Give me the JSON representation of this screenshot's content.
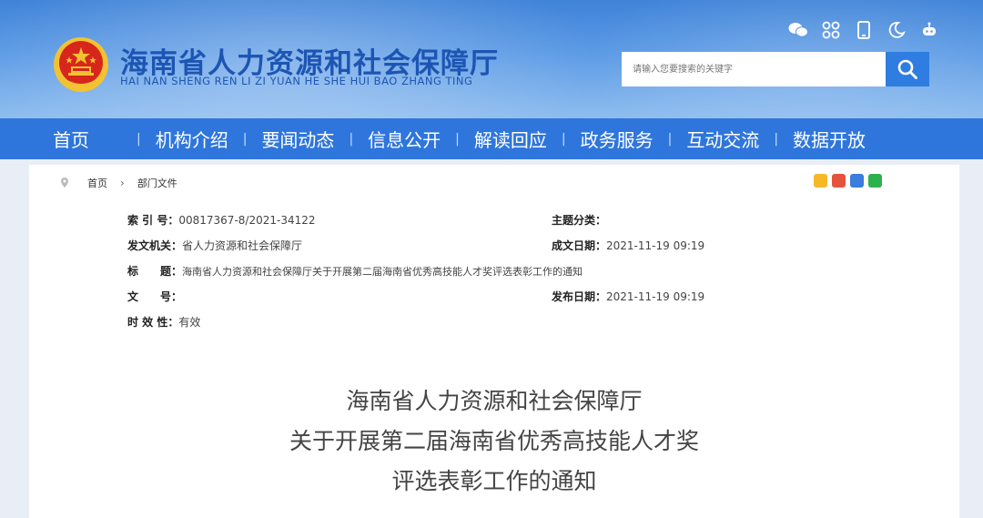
{
  "header": {
    "title": "海南省人力资源和社会保障厅",
    "subtitle": "HAI NAN SHENG REN LI ZI YUAN HE SHE HUI BAO ZHANG TING",
    "search_placeholder": "请输入您要搜索的关键字",
    "icons": [
      "wechat-icon",
      "app-grid-icon",
      "mobile-icon",
      "night-mode-icon",
      "robot-icon"
    ]
  },
  "nav": {
    "items": [
      {
        "label": "首页"
      },
      {
        "label": "机构介绍"
      },
      {
        "label": "要闻动态"
      },
      {
        "label": "信息公开"
      },
      {
        "label": "解读回应"
      },
      {
        "label": "政务服务"
      },
      {
        "label": "互动交流"
      },
      {
        "label": "数据开放"
      }
    ]
  },
  "breadcrumb": {
    "home": "首页",
    "current": "部门文件"
  },
  "meta": {
    "index_label": "索 引 号：",
    "index_value": "00817367-8/2021-34122",
    "topic_label": "主题分类：",
    "topic_value": "",
    "issuer_label": "发文机关：",
    "issuer_value": "省人力资源和社会保障厅",
    "date_label": "成文日期：",
    "date_value": "2021-11-19 09:19",
    "title_label": "标　　题：",
    "title_value": "海南省人力资源和社会保障厅关于开展第二届海南省优秀高技能人才奖评选表彰工作的通知",
    "docno_label": "文　　号：",
    "docno_value": "",
    "publish_label": "发布日期：",
    "publish_value": "2021-11-19 09:19",
    "validity_label": "时 效 性：",
    "validity_value": "有效"
  },
  "document": {
    "title_line1": "海南省人力资源和社会保障厅",
    "title_line2": "关于开展第二届海南省优秀高技能人才奖",
    "title_line3": "评选表彰工作的通知"
  },
  "colors": {
    "nav_bg": "#2f76dc",
    "title_blue": "#1d55b3",
    "emblem_red": "#d7261b",
    "emblem_gold": "#f2c232"
  }
}
